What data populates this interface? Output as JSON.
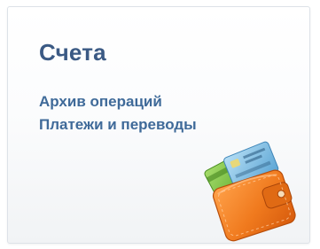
{
  "widget": {
    "title": "Счета",
    "links": [
      {
        "label": "Архив операций"
      },
      {
        "label": "Платежи и переводы"
      }
    ],
    "icon": "wallet-with-cards-icon",
    "colors": {
      "title": "#3b5a84",
      "link": "#3f6a99",
      "wallet": "#f07a1e",
      "card_green": "#7cc242",
      "card_blue": "#6fb7e3"
    }
  }
}
